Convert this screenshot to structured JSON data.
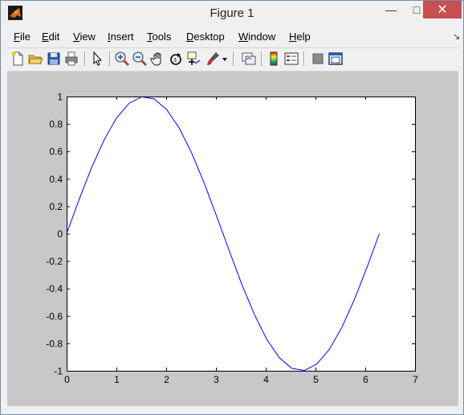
{
  "window": {
    "title": "Figure 1",
    "minimize_symbol": "—",
    "maximize_symbol": "□",
    "close_symbol": "✕"
  },
  "menubar": {
    "items": [
      {
        "mnemonic": "F",
        "rest": "ile"
      },
      {
        "mnemonic": "E",
        "rest": "dit"
      },
      {
        "mnemonic": "V",
        "rest": "iew"
      },
      {
        "mnemonic": "I",
        "rest": "nsert"
      },
      {
        "mnemonic": "T",
        "rest": "ools"
      },
      {
        "mnemonic": "D",
        "rest": "esktop"
      },
      {
        "mnemonic": "W",
        "rest": "indow"
      },
      {
        "mnemonic": "H",
        "rest": "elp"
      }
    ],
    "dock_symbol": "↘"
  },
  "toolbar": {
    "icons": [
      "new-figure-icon",
      "open-file-icon",
      "save-icon",
      "print-icon",
      "edit-plot-arrow-icon",
      "zoom-in-icon",
      "zoom-out-icon",
      "pan-hand-icon",
      "rotate-3d-icon",
      "data-cursor-icon",
      "brush-icon",
      "brush-dropdown-icon",
      "link-plot-icon",
      "colorbar-icon",
      "legend-icon",
      "hide-plot-tools-icon",
      "show-plot-tools-icon"
    ]
  },
  "chart_data": {
    "type": "line",
    "title": "",
    "xlabel": "",
    "ylabel": "",
    "xlim": [
      0,
      7
    ],
    "ylim": [
      -1,
      1
    ],
    "xticks": [
      "0",
      "1",
      "2",
      "3",
      "4",
      "5",
      "6",
      "7"
    ],
    "yticks": [
      "-1",
      "-0.8",
      "-0.6",
      "-0.4",
      "-0.2",
      "0",
      "0.2",
      "0.4",
      "0.6",
      "0.8",
      "1"
    ],
    "grid": false,
    "legend": "none",
    "series": [
      {
        "color": "#0000ff",
        "x": [
          0,
          0.2513,
          0.5027,
          0.754,
          1.0053,
          1.2566,
          1.508,
          1.7593,
          2.0106,
          2.2619,
          2.5133,
          2.7646,
          3.0159,
          3.2673,
          3.5186,
          3.7699,
          4.0212,
          4.2726,
          4.5239,
          4.7752,
          5.0265,
          5.2779,
          5.5292,
          5.7805,
          6.0319,
          6.2832
        ],
        "y": [
          0,
          0.2487,
          0.4818,
          0.6845,
          0.8443,
          0.9511,
          0.998,
          0.9823,
          0.9048,
          0.7705,
          0.5878,
          0.3681,
          0.1253,
          -0.1253,
          -0.3681,
          -0.5878,
          -0.7705,
          -0.9048,
          -0.9823,
          -0.998,
          -0.9511,
          -0.8443,
          -0.6845,
          -0.4818,
          -0.2487,
          0
        ]
      }
    ]
  }
}
